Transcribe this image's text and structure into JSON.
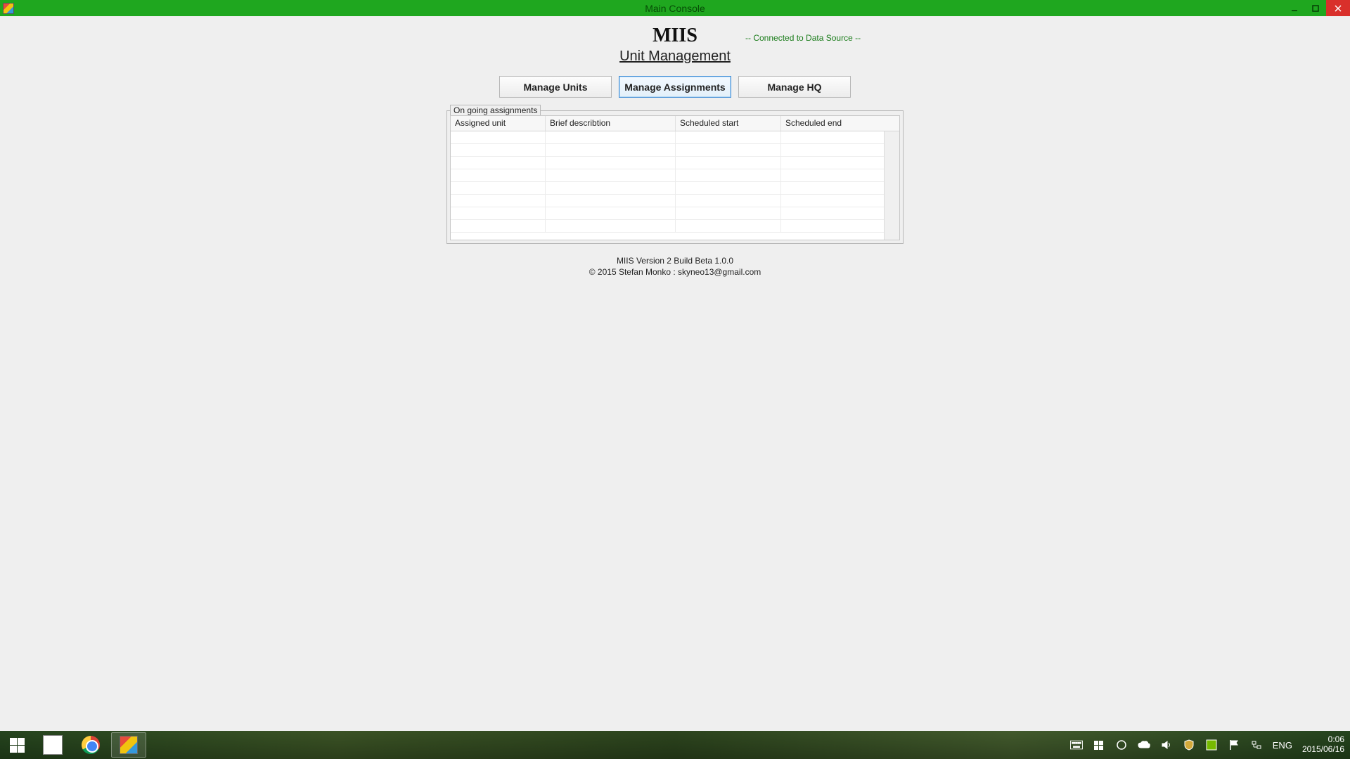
{
  "window": {
    "title": "Main Console"
  },
  "header": {
    "app_name": "MIIS",
    "subtitle": "Unit Management",
    "connection_status": "-- Connected to Data Source --"
  },
  "tabs": {
    "manage_units": "Manage Units",
    "manage_assignments": "Manage Assignments",
    "manage_hq": "Manage HQ"
  },
  "assignments_panel": {
    "label": "On going assignments",
    "columns": {
      "assigned_unit": "Assigned unit",
      "brief_description": "Brief describtion",
      "scheduled_start": "Scheduled start",
      "scheduled_end": "Scheduled end"
    },
    "rows": []
  },
  "footer": {
    "line1": "MIIS Version 2 Build Beta 1.0.0",
    "line2": "© 2015 Stefan Monko : skyneo13@gmail.com"
  },
  "taskbar": {
    "language": "ENG",
    "time": "0:06",
    "date": "2015/06/16"
  }
}
